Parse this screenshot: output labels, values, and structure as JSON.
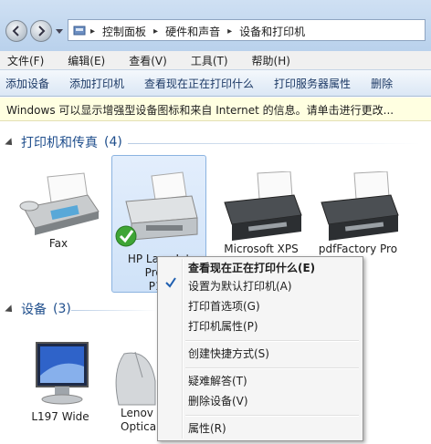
{
  "address": {
    "crumbs": [
      "控制面板",
      "硬件和声音",
      "设备和打印机"
    ]
  },
  "menu": [
    "文件(F)",
    "编辑(E)",
    "查看(V)",
    "工具(T)",
    "帮助(H)"
  ],
  "toolbar": [
    "添加设备",
    "添加打印机",
    "查看现在正在打印什么",
    "打印服务器属性",
    "删除"
  ],
  "infobar": "Windows 可以显示增强型设备图标和来自 Internet 的信息。请单击进行更改...",
  "printers_group": {
    "title": "打印机和传真",
    "count": "(4)"
  },
  "printers": [
    {
      "label": "Fax"
    },
    {
      "label": "HP LaserJet Profe… P16…"
    },
    {
      "label": "Microsoft XPS"
    },
    {
      "label": "pdfFactory Pro"
    }
  ],
  "hp_label_lines": [
    "HP LaserJet",
    "Profe",
    "P16"
  ],
  "devices_group": {
    "title": "设备",
    "count": "(3)"
  },
  "devices": [
    {
      "label": "L197 Wide"
    },
    {
      "label_lines": [
        "Lenov",
        "Optica"
      ]
    }
  ],
  "context_menu": {
    "items": [
      {
        "label": "查看现在正在打印什么(E)",
        "bold": true
      },
      {
        "label": "设置为默认打印机(A)",
        "checked": true
      },
      {
        "label": "打印首选项(G)"
      },
      {
        "label": "打印机属性(P)"
      },
      {
        "label": "创建快捷方式(S)"
      },
      {
        "label": "疑难解答(T)"
      },
      {
        "label": "删除设备(V)"
      },
      {
        "label": "属性(R)"
      }
    ]
  },
  "colors": {
    "group_title": "#1f4e8c",
    "toolbar_text": "#1d3a66",
    "infobar_bg": "#ffffe1"
  }
}
